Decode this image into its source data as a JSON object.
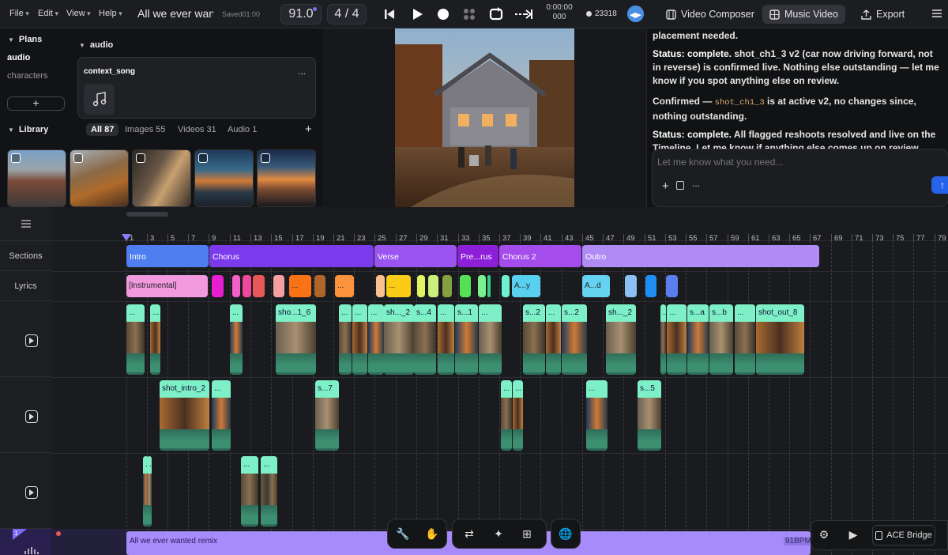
{
  "menu": {
    "file": "File",
    "edit": "Edit",
    "view": "View",
    "help": "Help"
  },
  "project": {
    "title": "All we ever want",
    "saved": "Saved01:00"
  },
  "transport": {
    "bpm": "91.0",
    "signature": "4 / 4",
    "time_top": "0:00:00",
    "time_bottom": "000",
    "credits": "23318"
  },
  "nav": {
    "video_composer": "Video Composer",
    "music_video": "Music Video",
    "export": "Export"
  },
  "plans": {
    "title": "Plans",
    "items": [
      "audio",
      "characters"
    ],
    "add": "+"
  },
  "audio": {
    "title": "audio",
    "card_title": "context_song",
    "card_more": "..."
  },
  "library": {
    "title": "Library",
    "filters": [
      "All 87",
      "Images 55",
      "Videos 31",
      "Audio 1"
    ],
    "add": "+"
  },
  "chat": {
    "p1": "placement needed.",
    "p2_bold": "Status: complete.",
    "p2": " shot_ch1_3 v2 (car now driving forward, not in reverse) is confirmed live. Nothing else outstanding — let me know if you spot anything else on review.",
    "p3a": "Confirmed — ",
    "p3code": "shot_ch1_3",
    "p3b": " is at active v2, no changes since, nothing outstanding.",
    "p4_bold": "Status: complete.",
    "p4": " All flagged reshoots resolved and live on the Timeline. Let me know if anything else comes up on review.",
    "placeholder": "Let me know what you need...",
    "more": "..."
  },
  "timeline": {
    "labels": {
      "sections": "Sections",
      "lyrics": "Lyrics"
    },
    "ruler": [
      "1",
      "3",
      "5",
      "7",
      "9",
      "11",
      "13",
      "15",
      "17",
      "19",
      "21",
      "23",
      "25",
      "27",
      "29",
      "31",
      "33",
      "35",
      "37",
      "39",
      "41",
      "43",
      "45",
      "47",
      "49",
      "51",
      "53",
      "55",
      "57",
      "59",
      "61",
      "63",
      "65",
      "67",
      "69",
      "71",
      "73",
      "75",
      "77",
      "79"
    ],
    "sections": [
      {
        "label": "Intro",
        "color": "#4f7ef0"
      },
      {
        "label": "Chorus",
        "color": "#7c3aed"
      },
      {
        "label": "Verse",
        "color": "#9a55f0"
      },
      {
        "label": "Pre...rus",
        "color": "#8e1fd8"
      },
      {
        "label": "Chorus 2",
        "color": "#a54cec"
      },
      {
        "label": "Outro",
        "color": "#b08af5"
      }
    ],
    "lyrics": [
      {
        "label": "[Instrumental]",
        "color": "#f29ae0"
      },
      {
        "label": "...",
        "color": "#f97316"
      },
      {
        "label": "...",
        "color": "#fb923c"
      },
      {
        "label": "...",
        "color": "#facc15"
      },
      {
        "label": "A...y",
        "color": "#5ad0f0"
      },
      {
        "label": "A...d",
        "color": "#66d2f2"
      }
    ],
    "track1": [
      "...",
      "...",
      "...",
      "sho...1_6",
      "...",
      "...",
      "...",
      "sh..._2",
      "s...4",
      "...",
      "s...1",
      "...",
      "s...2",
      "...",
      "s...2",
      "sh..._2",
      "...",
      "...",
      "s...a",
      "s...b",
      "...",
      "shot_out_8"
    ],
    "track2": [
      "shot_intro_2",
      "...",
      "s...7",
      "...",
      "...",
      "...",
      "s...5"
    ],
    "track3": [
      "...",
      "...",
      "..."
    ],
    "audio_track": "All we ever wanted remix",
    "audio_bpm": "91BPM",
    "audio_track_num": "1"
  },
  "bottom": {
    "ace": "ACE Bridge"
  }
}
